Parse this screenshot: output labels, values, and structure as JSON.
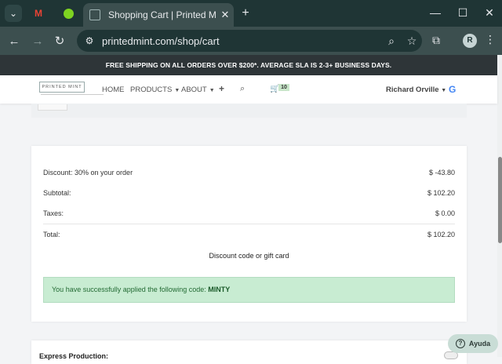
{
  "browser": {
    "tab_title": "Shopping Cart | Printed Mint",
    "url": "printedmint.com/shop/cart",
    "avatar_letter": "R"
  },
  "site": {
    "promo": "FREE SHIPPING ON ALL ORDERS OVER $200*. AVERAGE SLA IS 2-3+ BUSINESS DAYS.",
    "logo_text": "PRINTED MINT",
    "nav": {
      "home": "HOME",
      "products": "PRODUCTS",
      "about": "ABOUT"
    },
    "cart_count": "10",
    "user_name": "Richard Orville",
    "google_letter": "G"
  },
  "summary": {
    "discount_label": "Discount: 30% on your order",
    "discount_amount": "$ -43.80",
    "subtotal_label": "Subtotal:",
    "subtotal_amount": "$ 102.20",
    "taxes_label": "Taxes:",
    "taxes_amount": "$ 0.00",
    "total_label": "Total:",
    "total_amount": "$ 102.20",
    "discount_link": "Discount code or gift card",
    "alert_text": "You have successfully applied the following code: ",
    "alert_code": "MINTY"
  },
  "express": {
    "title": "Express Production:"
  },
  "help": {
    "label": "Ayuda"
  }
}
